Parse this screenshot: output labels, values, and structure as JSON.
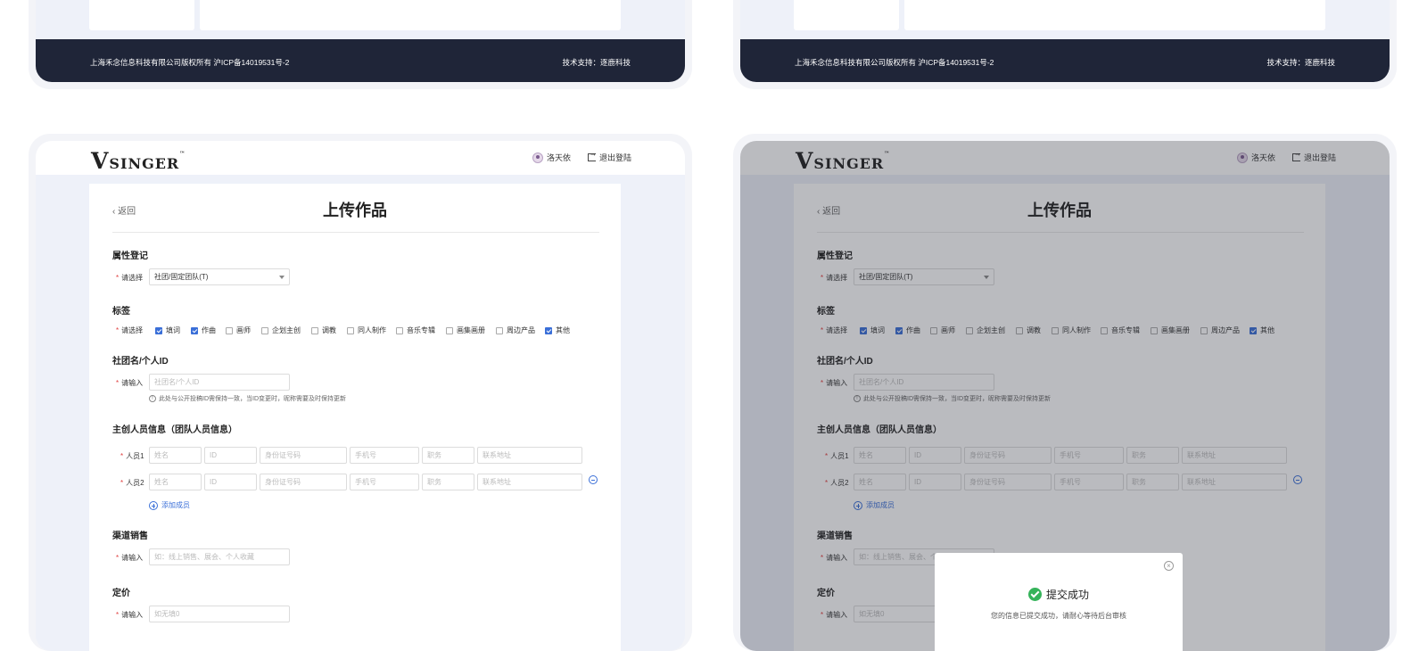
{
  "footer": {
    "copyright": "上海禾念信息科技有限公司版权所有 沪ICP备14019531号-2",
    "support": "技术支持：逐鹿科技"
  },
  "header": {
    "logo_v": "V",
    "logo_rest": "SINGER",
    "logo_tm": "™",
    "user_name": "洛天依",
    "logout": "退出登陆"
  },
  "form": {
    "back": "返回",
    "title": "上传作品",
    "attr_section": "属性登记",
    "select_label": "请选择",
    "input_label": "请输入",
    "attr_value": "社团/固定团队(T)",
    "tag_section": "标签",
    "tags": [
      {
        "label": "填词",
        "checked": true
      },
      {
        "label": "作曲",
        "checked": true
      },
      {
        "label": "画师",
        "checked": false
      },
      {
        "label": "企划主创",
        "checked": false
      },
      {
        "label": "调教",
        "checked": false
      },
      {
        "label": "同人制作",
        "checked": false
      },
      {
        "label": "音乐专辑",
        "checked": false
      },
      {
        "label": "画集画册",
        "checked": false
      },
      {
        "label": "周边产品",
        "checked": false
      },
      {
        "label": "其他",
        "checked": true
      }
    ],
    "id_section": "社团名/个人ID",
    "id_placeholder": "社团名/个人ID",
    "id_hint": "此处与公开投稿ID需保持一致，当ID变更时，昵称需要及时保持更新",
    "member_section": "主创人员信息（团队人员信息）",
    "member1_label": "人员1",
    "member2_label": "人员2",
    "member_fields": [
      "姓名",
      "ID",
      "身份证号码",
      "手机号",
      "职务",
      "联系地址"
    ],
    "add_member": "添加成员",
    "channel_section": "渠道销售",
    "channel_placeholder": "如：线上销售、展会、个人收藏",
    "price_section": "定价",
    "price_placeholder": "如无填0"
  },
  "modal": {
    "title": "提交成功",
    "message": "您的信息已提交成功，请耐心等待后台审核"
  }
}
